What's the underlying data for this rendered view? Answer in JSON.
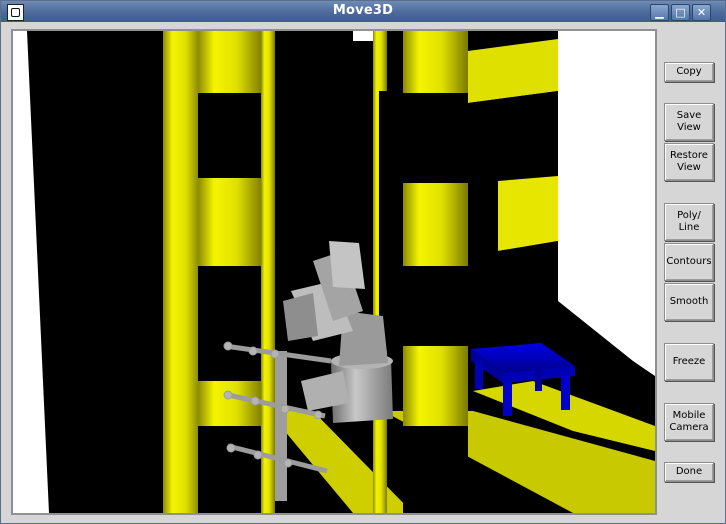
{
  "window": {
    "title": "Move3D",
    "app_icon": "move3d-app-icon",
    "title_buttons": [
      {
        "name": "minimize-button",
        "icon": "minimize-icon",
        "glyph": "▁"
      },
      {
        "name": "maximize-button",
        "icon": "maximize-icon",
        "glyph": "□"
      },
      {
        "name": "close-button",
        "icon": "close-icon",
        "glyph": "✕"
      }
    ]
  },
  "toolbar": {
    "buttons": [
      {
        "name": "copy-button",
        "label": "Copy"
      },
      {
        "name": "save-view-button",
        "label": "Save\nView"
      },
      {
        "name": "restore-view-button",
        "label": "Restore\nView"
      },
      {
        "name": "poly-line-button",
        "label": "Poly/\nLine"
      },
      {
        "name": "contours-button",
        "label": "Contours"
      },
      {
        "name": "smooth-button",
        "label": "Smooth"
      },
      {
        "name": "freeze-button",
        "label": "Freeze"
      },
      {
        "name": "mobile-camera-button",
        "label": "Mobile\nCamera"
      },
      {
        "name": "done-button",
        "label": "Done"
      }
    ]
  },
  "scene": {
    "colors": {
      "pillar_yellow": "#e6e600",
      "floor_yellow": "#d7d700",
      "robot_gray": "#a8a8a8",
      "table_blue": "#0000c8",
      "background": "#ffffff"
    }
  }
}
